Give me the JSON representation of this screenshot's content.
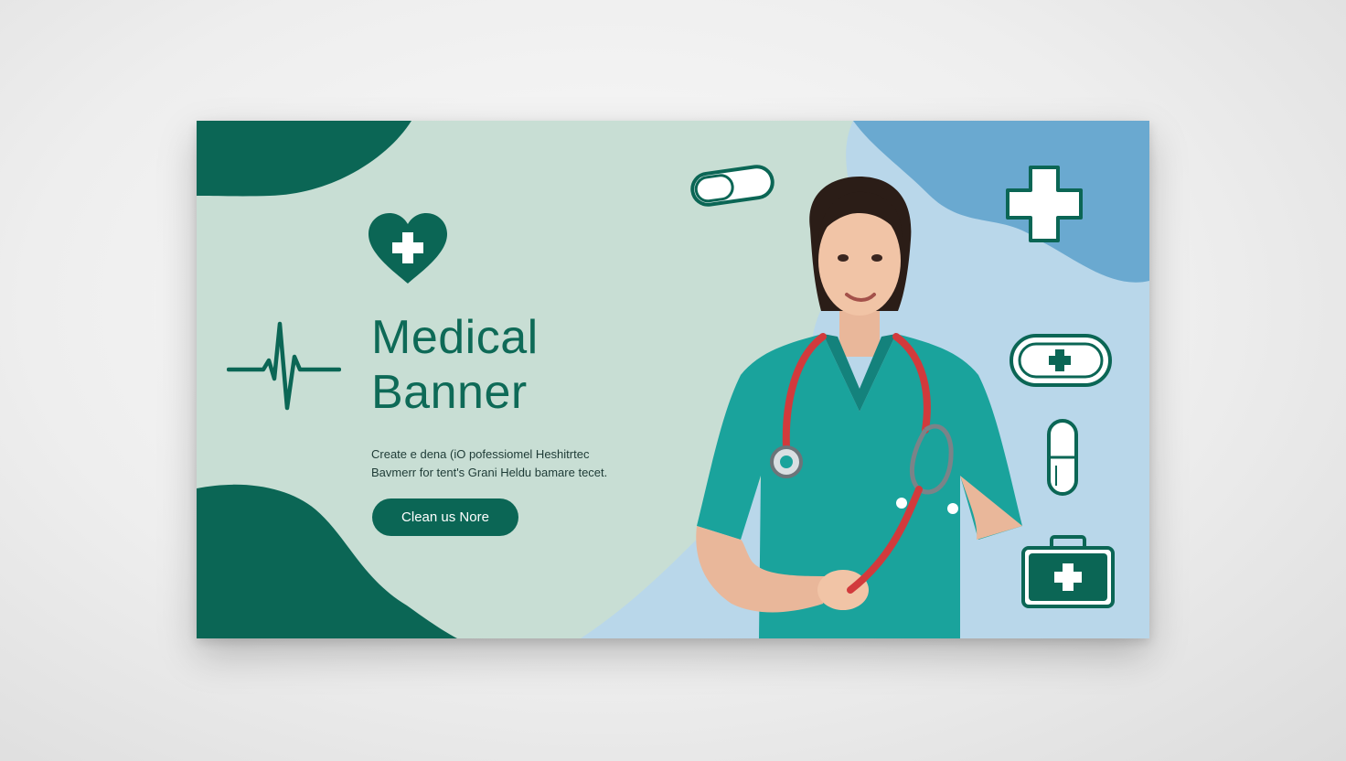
{
  "banner": {
    "title_line1": "Medical",
    "title_line2": "Banner",
    "body_line1": "Create e dena  (iO pofessiomel Heshitrtec",
    "body_line2": "Bavmerr for tent's  Grani Heldu bamare tecet.",
    "cta_label": "Clean us Nore"
  },
  "colors": {
    "dark_green": "#0b6655",
    "mint_background": "#c8ded4",
    "light_blue": "#b9d7ea",
    "sky_blue": "#6aa9d0",
    "scrubs_teal": "#1aa39c",
    "stethoscope_red": "#d23a3c"
  },
  "icons": [
    "heart-plus-icon",
    "heartbeat-line-icon",
    "capsule-icon",
    "medical-cross-icon",
    "pill-plus-icon",
    "vertical-capsule-icon",
    "first-aid-kit-icon"
  ]
}
